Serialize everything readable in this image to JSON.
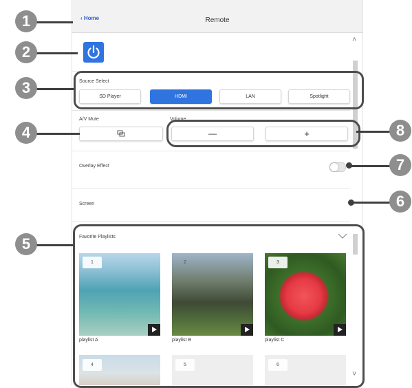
{
  "header": {
    "back_label": "Home",
    "title": "Remote"
  },
  "source_select": {
    "label": "Source Select",
    "options": [
      "SD Player",
      "HDMI",
      "LAN",
      "Spotlight"
    ],
    "selected": "HDMI"
  },
  "av_mute": {
    "label": "A/V Mute"
  },
  "volume": {
    "label": "Volume",
    "minus": "—",
    "plus": "+"
  },
  "overlay": {
    "label": "Overlay Effect",
    "enabled": false
  },
  "screen": {
    "label": "Screen"
  },
  "favorites": {
    "label": "Favorite Playlists",
    "items": [
      {
        "number": "1",
        "name": "playlist A"
      },
      {
        "number": "2",
        "name": "playlist B"
      },
      {
        "number": "3",
        "name": "playlist C"
      },
      {
        "number": "4",
        "name": ""
      },
      {
        "number": "5",
        "name": ""
      },
      {
        "number": "6",
        "name": ""
      }
    ]
  },
  "callouts": [
    "1",
    "2",
    "3",
    "4",
    "5",
    "6",
    "7",
    "8"
  ],
  "colors": {
    "accent": "#2f74df",
    "callout": "#8e8e8e",
    "highlight": "#4d4d4d"
  },
  "icons": {
    "back": "chevron-left-icon",
    "power": "power-icon",
    "mute": "av-mute-icon",
    "play": "play-icon",
    "collapse": "chevron-down-icon"
  }
}
